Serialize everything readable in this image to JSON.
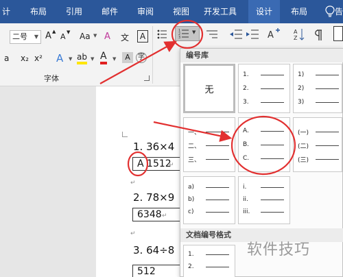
{
  "tabs": [
    {
      "label": "计",
      "active": false
    },
    {
      "label": "布局",
      "active": false
    },
    {
      "label": "引用",
      "active": false
    },
    {
      "label": "邮件",
      "active": false
    },
    {
      "label": "审阅",
      "active": false
    },
    {
      "label": "视图",
      "active": false
    },
    {
      "label": "开发工具",
      "active": false
    },
    {
      "label": "设计",
      "active": true
    },
    {
      "label": "布局",
      "active": false
    },
    {
      "label": "告",
      "active": false
    }
  ],
  "ribbon": {
    "font_size": "二号",
    "grow_font": "A",
    "shrink_font": "A",
    "change_case": "Aa",
    "clear_format": "A",
    "phonetic": "文",
    "char_border": "A",
    "bold": "a",
    "subscript": "x₂",
    "superscript": "x²",
    "text_effect": "A",
    "highlight": "ab",
    "font_color": "A",
    "char_shading": "A",
    "enclosed_char": "字",
    "group_font": "字体"
  },
  "document": {
    "q1": "1.   36×4",
    "q1_answer_letter": "A",
    "q1_answer": "1512",
    "q2": "2.   78×9",
    "q2_answer": "6348",
    "q3": "3.   64÷8",
    "q3_answer": "512",
    "para_mark": "↵"
  },
  "dropdown": {
    "library_title": "编号库",
    "none_label": "无",
    "lists": [
      [
        "1.",
        "2.",
        "3."
      ],
      [
        "1)",
        "2)",
        "3)"
      ],
      [
        "一、",
        "二、",
        "三、"
      ],
      [
        "A.",
        "B.",
        "C."
      ],
      [
        "(一)",
        "(二)",
        "(三)"
      ],
      [
        "a)",
        "b)",
        "c)"
      ],
      [
        "i.",
        "ii.",
        "iii."
      ]
    ],
    "doc_format_title": "文档编号格式",
    "doc_format_list": [
      "1.",
      "2."
    ]
  },
  "watermark": "软件技巧",
  "colors": {
    "ribbon_blue": "#2b579a",
    "annotation_red": "#e23030"
  }
}
